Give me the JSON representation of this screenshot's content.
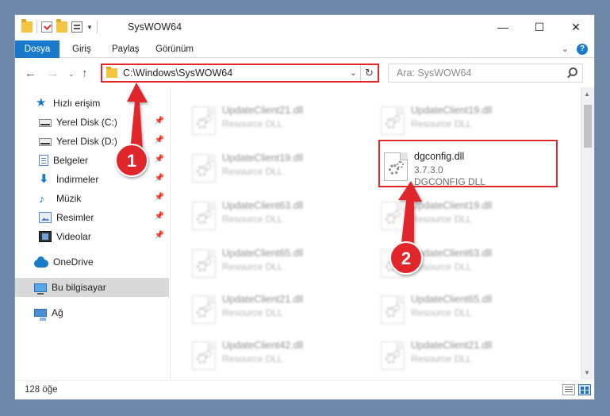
{
  "window": {
    "title": "SysWOW64",
    "controls": {
      "minimize": "—",
      "maximize": "☐",
      "close": "✕"
    }
  },
  "ribbon": {
    "tabs": [
      "Dosya",
      "Giriş",
      "Paylaş",
      "Görünüm"
    ],
    "expand_icon": "⌄",
    "help_icon": "?"
  },
  "nav": {
    "back": "←",
    "forward": "→",
    "recent": "⌄",
    "up": "↑",
    "address": "C:\\Windows\\SysWOW64",
    "address_dropdown": "⌄",
    "refresh": "↻",
    "search_placeholder": "Ara: SysWOW64"
  },
  "sidebar": {
    "items": [
      {
        "label": "Hızlı erişim",
        "icon": "star-icon",
        "glyph": "★",
        "pinned": false
      },
      {
        "label": "Yerel Disk (C:)",
        "icon": "drive-icon",
        "glyph": "",
        "pinned": true
      },
      {
        "label": "Yerel Disk (D:)",
        "icon": "drive-icon",
        "glyph": "",
        "pinned": true
      },
      {
        "label": "Belgeler",
        "icon": "documents-icon",
        "glyph": "",
        "pinned": true
      },
      {
        "label": "İndirmeler",
        "icon": "download-icon",
        "glyph": "⬇",
        "pinned": true
      },
      {
        "label": "Müzik",
        "icon": "music-icon",
        "glyph": "♪",
        "pinned": true
      },
      {
        "label": "Resimler",
        "icon": "pictures-icon",
        "glyph": "",
        "pinned": true
      },
      {
        "label": "Videolar",
        "icon": "videos-icon",
        "glyph": "",
        "pinned": true
      },
      {
        "label": "OneDrive",
        "icon": "onedrive-icon",
        "glyph": "",
        "pinned": false
      },
      {
        "label": "Bu bilgisayar",
        "icon": "computer-icon",
        "glyph": "",
        "pinned": false,
        "selected": true
      },
      {
        "label": "Ağ",
        "icon": "network-icon",
        "glyph": "",
        "pinned": false
      }
    ],
    "pin_glyph": "📌"
  },
  "files": [
    {
      "name": "UpdateClient21.dll",
      "type": "Resource DLL",
      "faded": true
    },
    {
      "name": "UpdateClient19.dll",
      "type": "Resource DLL",
      "faded": true
    },
    {
      "name": "UpdateClient19.dll",
      "type": "Resource DLL",
      "faded": true
    },
    {
      "name": "dgconfig.dll",
      "version": "3.7.3.0",
      "type": "DGCONFIG DLL",
      "faded": false
    },
    {
      "name": "UpdateClient63.dll",
      "type": "Resource DLL",
      "faded": true
    },
    {
      "name": "UpdateClient19.dll",
      "type": "Resource DLL",
      "faded": true
    },
    {
      "name": "UpdateClient65.dll",
      "type": "Resource DLL",
      "faded": true
    },
    {
      "name": "UpdateClient63.dll",
      "type": "Resource DLL",
      "faded": true
    },
    {
      "name": "UpdateClient21.dll",
      "type": "Resource DLL",
      "faded": true
    },
    {
      "name": "UpdateClient65.dll",
      "type": "Resource DLL",
      "faded": true
    },
    {
      "name": "UpdateClient42.dll",
      "type": "Resource DLL",
      "faded": true
    },
    {
      "name": "UpdateClient21.dll",
      "type": "Resource DLL",
      "faded": true
    }
  ],
  "status": {
    "item_count": "128 öğe"
  },
  "annotations": {
    "step1": "1",
    "step2": "2",
    "color": "#e0282b"
  },
  "colors": {
    "accent": "#1979ca",
    "highlight": "#e0282b"
  }
}
